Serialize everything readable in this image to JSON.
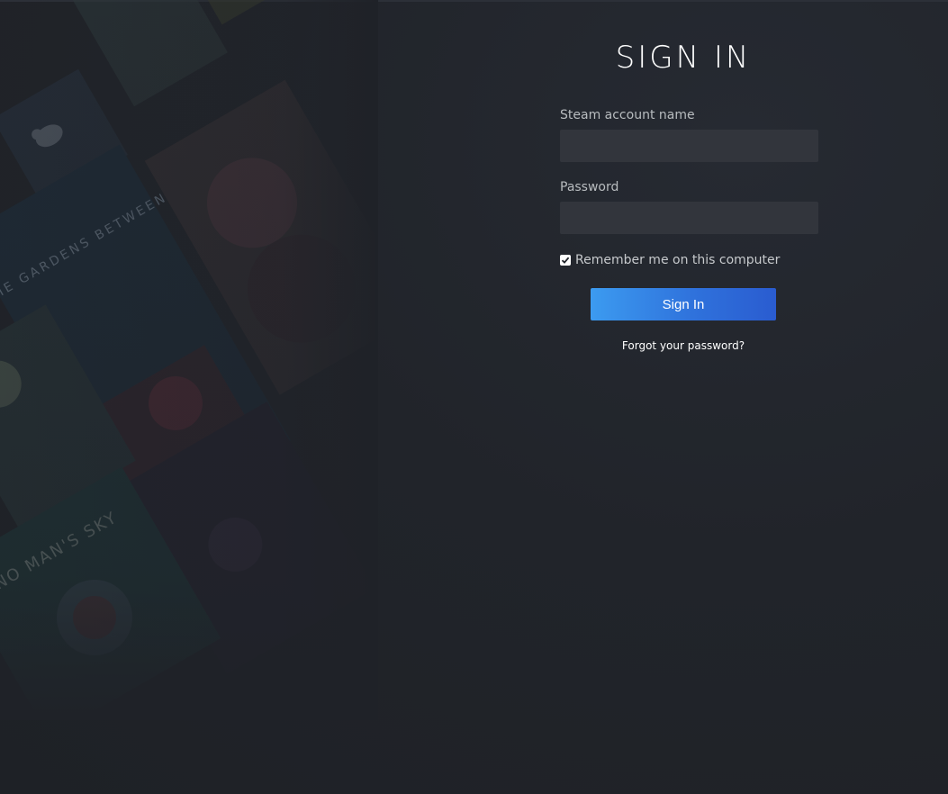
{
  "form": {
    "title": "SIGN IN",
    "account_label": "Steam account name",
    "account_value": "",
    "password_label": "Password",
    "password_value": "",
    "remember_label": "Remember me on this computer",
    "remember_checked": true,
    "signin_label": "Sign In",
    "forgot_label": "Forgot your password?"
  },
  "background": {
    "art_text_1": "THE GARDENS BETWEEN",
    "art_text_2": "NO MAN'S SKY"
  },
  "colors": {
    "background": "#1f2228",
    "input_bg": "#32353c",
    "button_start": "#3c9bf0",
    "button_end": "#2a5cd0"
  }
}
